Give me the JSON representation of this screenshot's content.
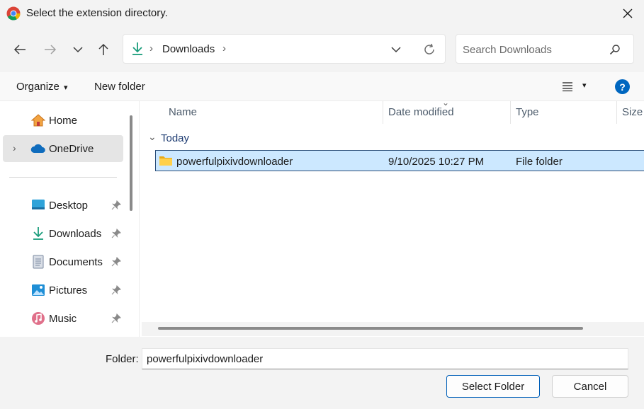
{
  "window": {
    "title": "Select the extension directory.",
    "close_glyph": "✕"
  },
  "nav": {
    "back_icon": "←",
    "forward_icon": "→",
    "recent_icon": "⌄",
    "up_icon": "↑",
    "breadcrumb": {
      "location": "Downloads",
      "separator": "›",
      "trailing_separator": "›"
    },
    "dropdown_icon": "⌄",
    "refresh_icon": "↻"
  },
  "search": {
    "placeholder": "Search Downloads"
  },
  "commands": {
    "organize": "Organize",
    "new_folder": "New folder",
    "caret": "▾",
    "help": "?"
  },
  "sidebar": {
    "items": [
      {
        "label": "Home"
      },
      {
        "label": "OneDrive",
        "chevron": "›"
      },
      {
        "label": "Desktop"
      },
      {
        "label": "Downloads"
      },
      {
        "label": "Documents"
      },
      {
        "label": "Pictures"
      },
      {
        "label": "Music"
      }
    ]
  },
  "columns": {
    "name": "Name",
    "date_modified": "Date modified",
    "type": "Type",
    "size": "Size",
    "sort_glyph": "⌄"
  },
  "groups": [
    {
      "label": "Today",
      "chevron": "⌄",
      "rows": [
        {
          "name": "powerfulpixivdownloader",
          "date": "9/10/2025 10:27 PM",
          "type": "File folder"
        }
      ]
    }
  ],
  "footer": {
    "folder_label": "Folder:",
    "folder_value": "powerfulpixivdownloader",
    "select_button": "Select Folder",
    "cancel_button": "Cancel"
  },
  "colors": {
    "accent": "#005fb8",
    "selection": "#cce8ff",
    "help": "#0067c0"
  }
}
